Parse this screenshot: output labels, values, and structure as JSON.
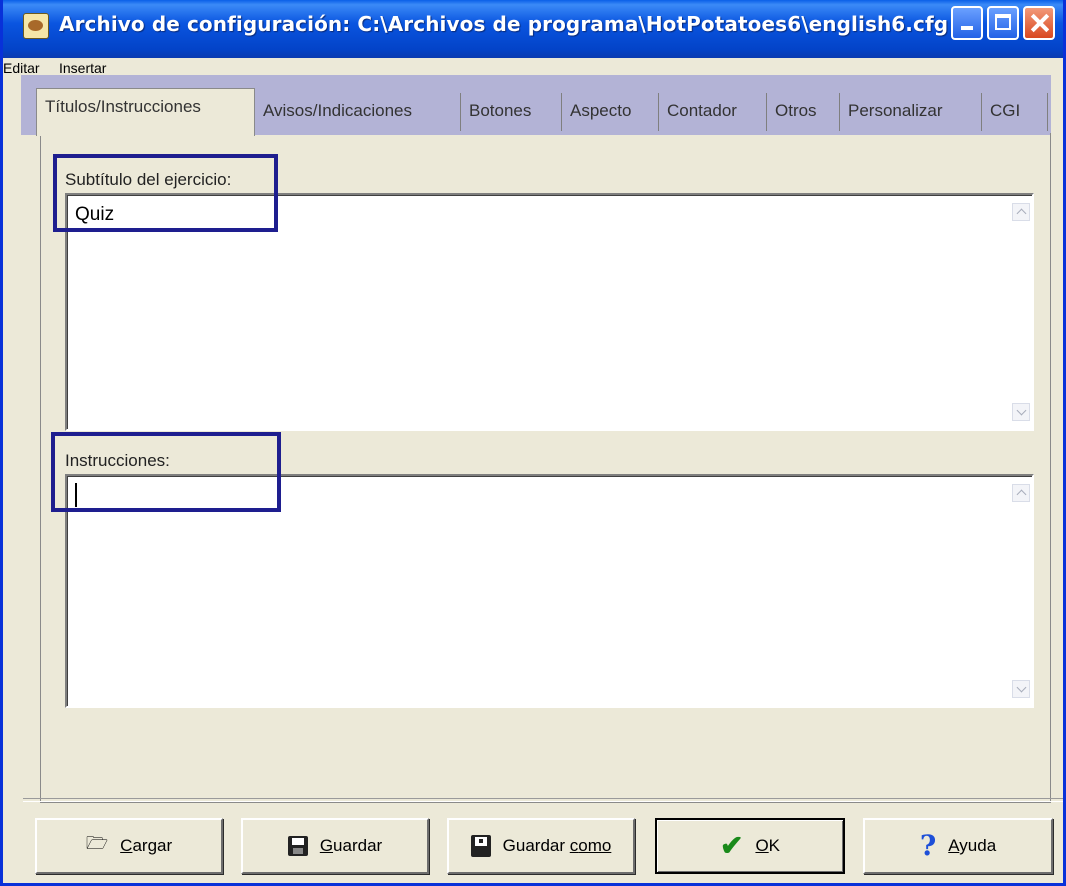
{
  "window": {
    "title": "Archivo de configuración: C:\\Archivos de programa\\HotPotatoes6\\english6.cfg"
  },
  "menu": [
    "Editar",
    "Insertar"
  ],
  "tabs": [
    {
      "label": "Títulos/Instrucciones",
      "active": true
    },
    {
      "label": "Avisos/Indicaciones",
      "active": false
    },
    {
      "label": "Botones",
      "active": false
    },
    {
      "label": "Aspecto",
      "active": false
    },
    {
      "label": "Contador",
      "active": false
    },
    {
      "label": "Otros",
      "active": false
    },
    {
      "label": "Personalizar",
      "active": false
    },
    {
      "label": "CGI",
      "active": false
    }
  ],
  "fields": {
    "subtitle": {
      "label": "Subtítulo del ejercicio:",
      "value": "Quiz"
    },
    "instructions": {
      "label": "Instrucciones:",
      "value": ""
    }
  },
  "buttons": {
    "load": {
      "mnemonic": "C",
      "rest": "argar"
    },
    "save": {
      "mnemonic": "G",
      "rest": "uardar"
    },
    "save_as": {
      "prefix": "Guardar ",
      "mnemonic": "c",
      "rest": "omo"
    },
    "ok": {
      "mnemonic": "O",
      "rest": "K"
    },
    "help": {
      "mnemonic": "A",
      "rest": "yuda"
    }
  },
  "colors": {
    "titlebar": "#0a55e0",
    "face": "#ece9d8",
    "tab_strip": "#b3b3d6",
    "highlight_box": "#1e1e8f"
  }
}
